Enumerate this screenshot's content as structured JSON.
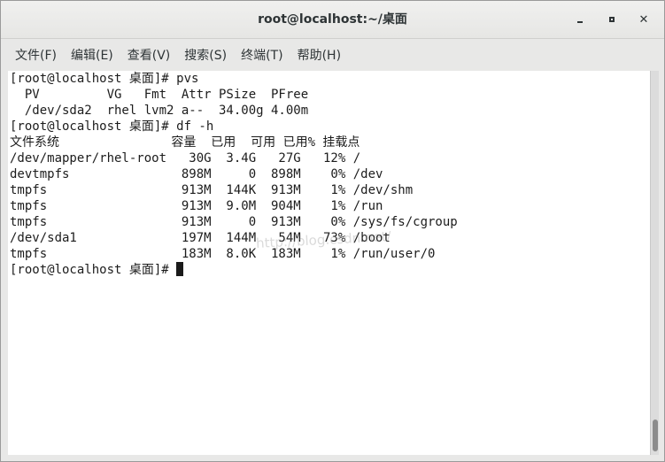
{
  "window": {
    "title": "root@localhost:~/桌面"
  },
  "menu": [
    {
      "label": "文件(F)",
      "name": "menu-file"
    },
    {
      "label": "编辑(E)",
      "name": "menu-edit"
    },
    {
      "label": "查看(V)",
      "name": "menu-view"
    },
    {
      "label": "搜索(S)",
      "name": "menu-search"
    },
    {
      "label": "终端(T)",
      "name": "menu-terminal"
    },
    {
      "label": "帮助(H)",
      "name": "menu-help"
    }
  ],
  "terminal": {
    "lines": [
      "[root@localhost 桌面]# pvs",
      "  PV         VG   Fmt  Attr PSize  PFree",
      "  /dev/sda2  rhel lvm2 a--  34.00g 4.00m",
      "[root@localhost 桌面]# df -h",
      "文件系统               容量  已用  可用 已用% 挂载点",
      "/dev/mapper/rhel-root   30G  3.4G   27G   12% /",
      "devtmpfs               898M     0  898M    0% /dev",
      "tmpfs                  913M  144K  913M    1% /dev/shm",
      "tmpfs                  913M  9.0M  904M    1% /run",
      "tmpfs                  913M     0  913M    0% /sys/fs/cgroup",
      "/dev/sda1              197M  144M   54M   73% /boot",
      "tmpfs                  183M  8.0K  183M    1% /run/user/0"
    ],
    "prompt": "[root@localhost 桌面]# ",
    "watermark": "http://blog.csdn.net/"
  }
}
